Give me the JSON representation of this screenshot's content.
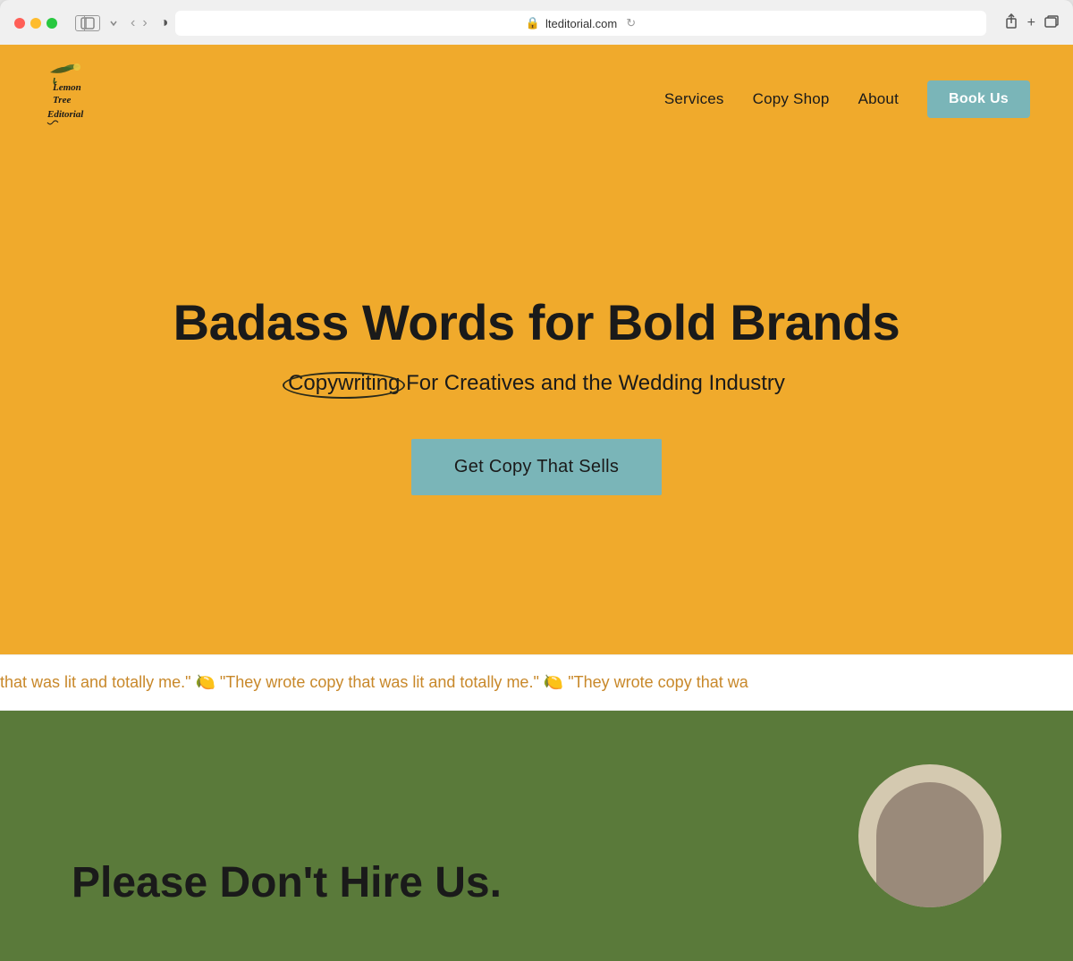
{
  "browser": {
    "url": "lteditorial.com",
    "tab_label": "lteditorial.com"
  },
  "nav": {
    "logo_line1": "Lemon",
    "logo_line2": "Tree",
    "logo_line3": "Editorial",
    "services_label": "Services",
    "copy_shop_label": "Copy Shop",
    "about_label": "About",
    "book_us_label": "Book Us"
  },
  "hero": {
    "title": "Badass Words for Bold Brands",
    "subtitle_highlight": "Copywriting",
    "subtitle_rest": " For Creatives and the Wedding Industry",
    "cta_label": "Get Copy That Sells"
  },
  "ticker": {
    "text": "that was lit and totally me.\" 🍋  \"They wrote copy that was lit and totally me.\" 🍋  \"They wrote copy that wa"
  },
  "green_section": {
    "title": "Please Don't Hire Us."
  }
}
